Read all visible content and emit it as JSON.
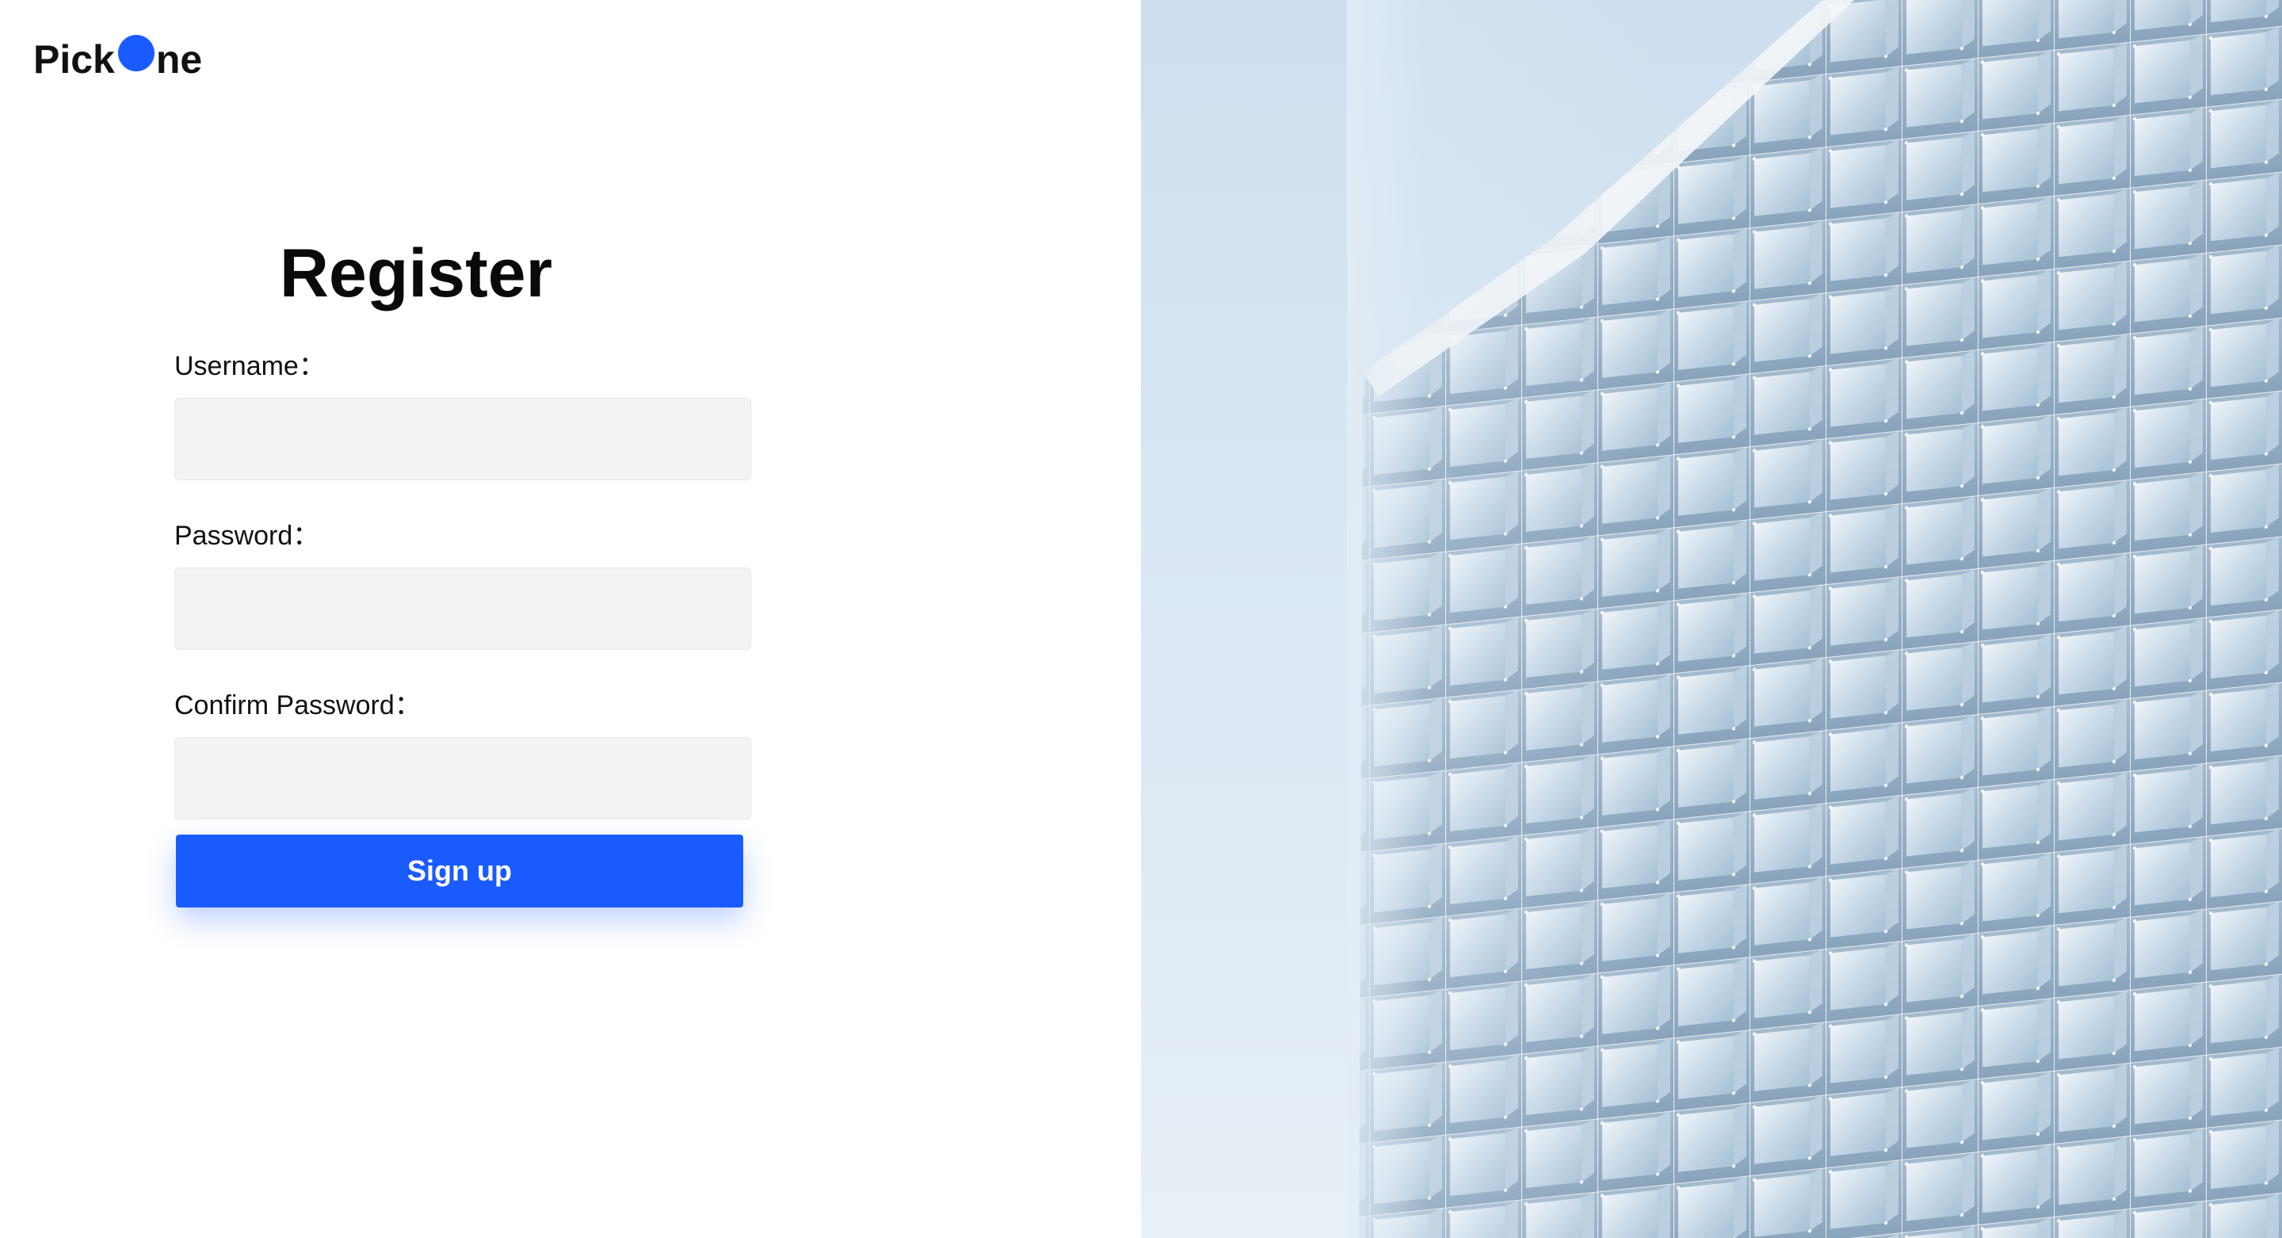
{
  "logo": {
    "text_before": "Pick",
    "text_after": "ne",
    "dot_color": "#1a5bff"
  },
  "form": {
    "title": "Register",
    "fields": [
      {
        "label": "Username：",
        "value": "",
        "placeholder": ""
      },
      {
        "label": "Password：",
        "value": "",
        "placeholder": ""
      },
      {
        "label": "Confirm Password：",
        "value": "",
        "placeholder": ""
      }
    ],
    "submit_label": "Sign up"
  },
  "colors": {
    "accent": "#1a5bff",
    "input_bg": "#f2f3f5",
    "sky": "#d6e6f3"
  },
  "hero_image": {
    "subject": "glass-building-facade"
  }
}
